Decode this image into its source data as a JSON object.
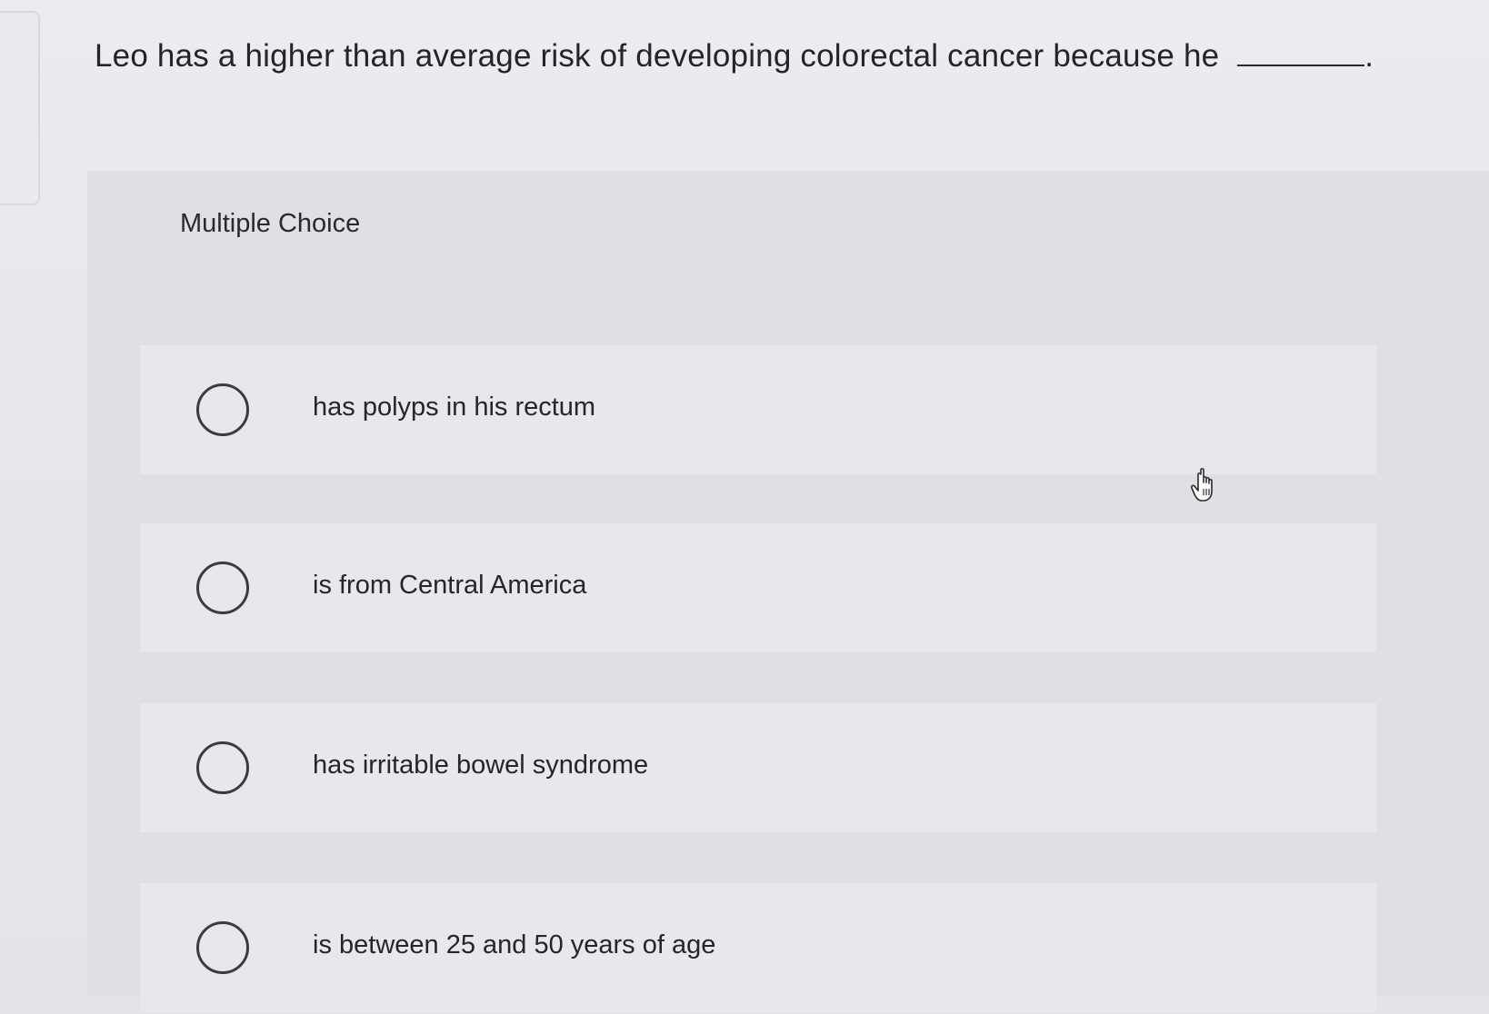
{
  "question": {
    "text": "Leo has a higher than average risk of developing colorectal cancer because he",
    "period": "."
  },
  "section_label": "Multiple Choice",
  "options": [
    {
      "label": "has polyps in his rectum",
      "selected": false
    },
    {
      "label": "is from Central America",
      "selected": false
    },
    {
      "label": "has irritable bowel syndrome",
      "selected": false
    },
    {
      "label": "is between 25 and 50 years of age",
      "selected": false
    }
  ],
  "icons": {
    "radio": "radio-empty-icon",
    "cursor": "hand-pointer-icon"
  }
}
